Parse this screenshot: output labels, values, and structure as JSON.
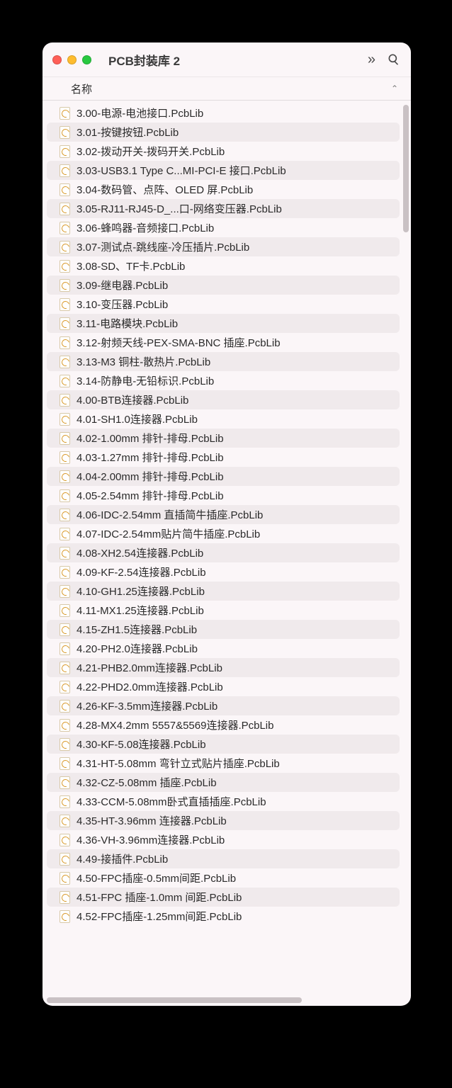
{
  "window": {
    "title": "PCB封装库 2"
  },
  "columns": {
    "name_label": "名称",
    "sort_indicator": "⌃"
  },
  "toolbar": {
    "more_glyph": "»"
  },
  "files": [
    "3.00-电源-电池接口.PcbLib",
    "3.01-按键按钮.PcbLib",
    "3.02-拨动开关-拨码开关.PcbLib",
    "3.03-USB3.1 Type C...MI-PCI-E 接口.PcbLib",
    "3.04-数码管、点阵、OLED 屏.PcbLib",
    "3.05-RJ11-RJ45-D_...口-网络变压器.PcbLib",
    "3.06-蜂鸣器-音频接口.PcbLib",
    "3.07-测试点-跳线座-冷压插片.PcbLib",
    "3.08-SD、TF卡.PcbLib",
    "3.09-继电器.PcbLib",
    "3.10-变压器.PcbLib",
    "3.11-电路模块.PcbLib",
    "3.12-射频天线-PEX-SMA-BNC 插座.PcbLib",
    "3.13-M3 铜柱-散热片.PcbLib",
    "3.14-防静电-无铅标识.PcbLib",
    "4.00-BTB连接器.PcbLib",
    "4.01-SH1.0连接器.PcbLib",
    "4.02-1.00mm 排针-排母.PcbLib",
    "4.03-1.27mm 排针-排母.PcbLib",
    "4.04-2.00mm 排针-排母.PcbLib",
    "4.05-2.54mm 排针-排母.PcbLib",
    "4.06-IDC-2.54mm 直插简牛插座.PcbLib",
    "4.07-IDC-2.54mm贴片简牛插座.PcbLib",
    "4.08-XH2.54连接器.PcbLib",
    "4.09-KF-2.54连接器.PcbLib",
    "4.10-GH1.25连接器.PcbLib",
    "4.11-MX1.25连接器.PcbLib",
    "4.15-ZH1.5连接器.PcbLib",
    "4.20-PH2.0连接器.PcbLib",
    "4.21-PHB2.0mm连接器.PcbLib",
    "4.22-PHD2.0mm连接器.PcbLib",
    "4.26-KF-3.5mm连接器.PcbLib",
    "4.28-MX4.2mm 5557&5569连接器.PcbLib",
    "4.30-KF-5.08连接器.PcbLib",
    "4.31-HT-5.08mm 弯针立式贴片插座.PcbLib",
    "4.32-CZ-5.08mm 插座.PcbLib",
    "4.33-CCM-5.08mm卧式直插插座.PcbLib",
    "4.35-HT-3.96mm 连接器.PcbLib",
    "4.36-VH-3.96mm连接器.PcbLib",
    "4.49-接插件.PcbLib",
    "4.50-FPC插座-0.5mm间距.PcbLib",
    "4.51-FPC 插座-1.0mm 间距.PcbLib",
    "4.52-FPC插座-1.25mm间距.PcbLib"
  ]
}
